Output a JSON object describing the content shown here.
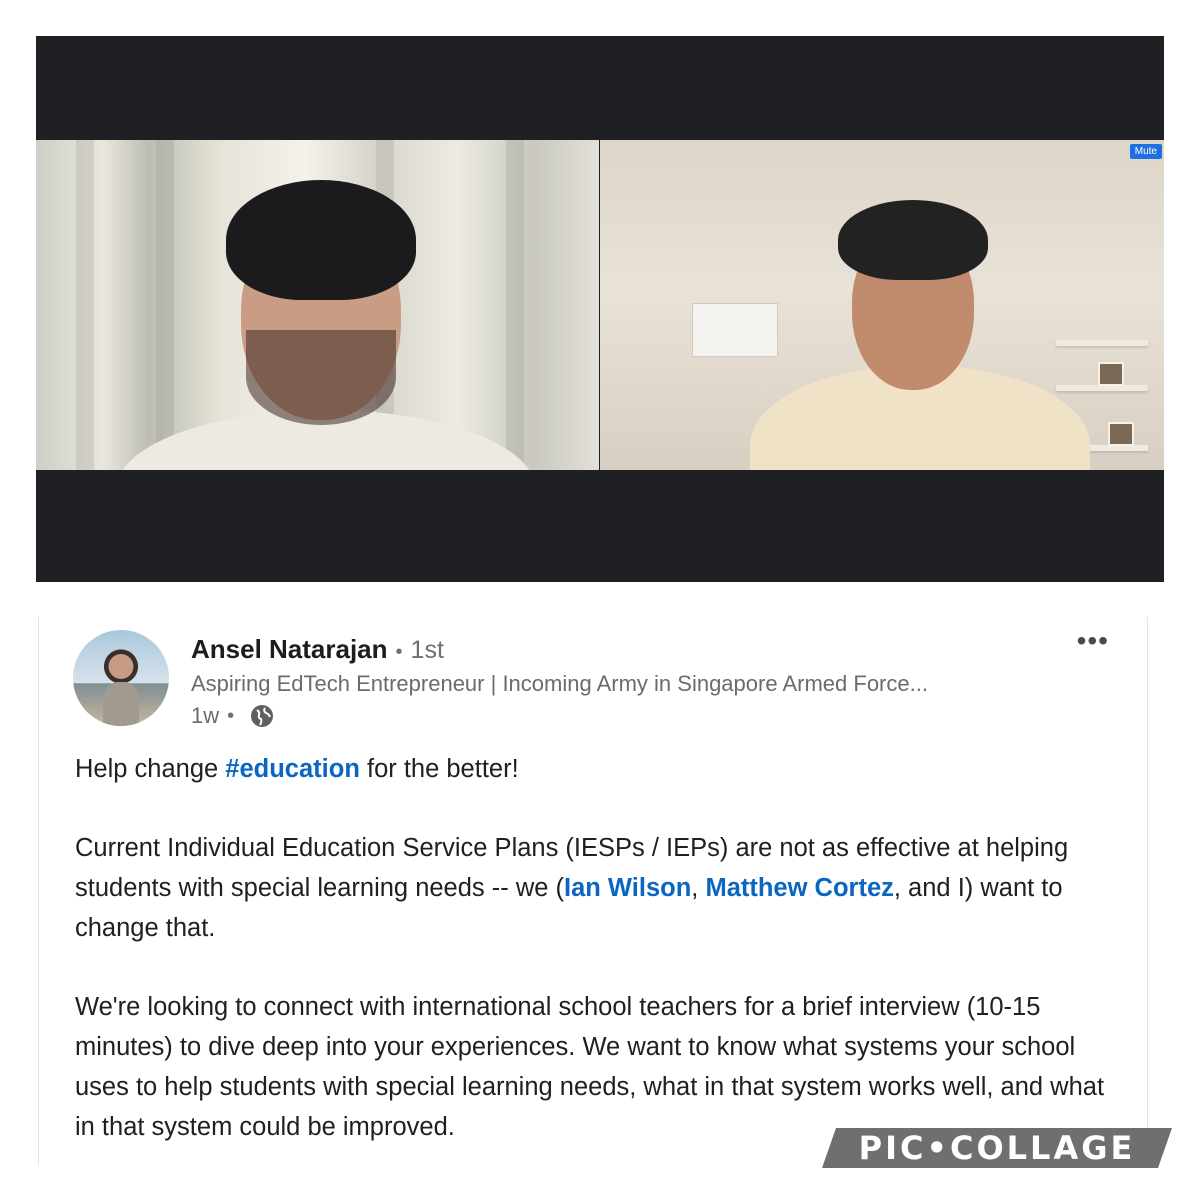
{
  "video_call": {
    "participants": [
      {
        "label": "participant-left"
      },
      {
        "label": "participant-right"
      }
    ],
    "mute_label": "Mute"
  },
  "post": {
    "author": {
      "name": "Ansel Natarajan",
      "degree": "1st",
      "separator": "•",
      "headline": "Aspiring EdTech Entrepreneur | Incoming Army in Singapore Armed Force...",
      "time": "1w",
      "visibility_icon": "globe-icon"
    },
    "more_label": "•••",
    "body": {
      "p1_before": "Help change ",
      "hashtag": "#education",
      "p1_after": " for the better!",
      "p2_text1": "Current Individual Education Service Plans (IESPs / IEPs) are not as effective at helping students with special learning needs -- we (",
      "mention1": "Ian Wilson",
      "p2_text2": ", ",
      "mention2": "Matthew Cortez",
      "p2_text3": ", and I) want to change that.",
      "p3": "We're looking to connect with international school teachers for a brief interview (10-15 minutes) to dive deep into your experiences. We want to know what systems your school uses to help students with special learning needs, what in that system works well, and what in that system could be improved."
    }
  },
  "watermark": "PIC•COLLAGE",
  "colors": {
    "link": "#0a66c2",
    "call_background": "#1f2023",
    "mute_badge": "#1f6fe0"
  }
}
